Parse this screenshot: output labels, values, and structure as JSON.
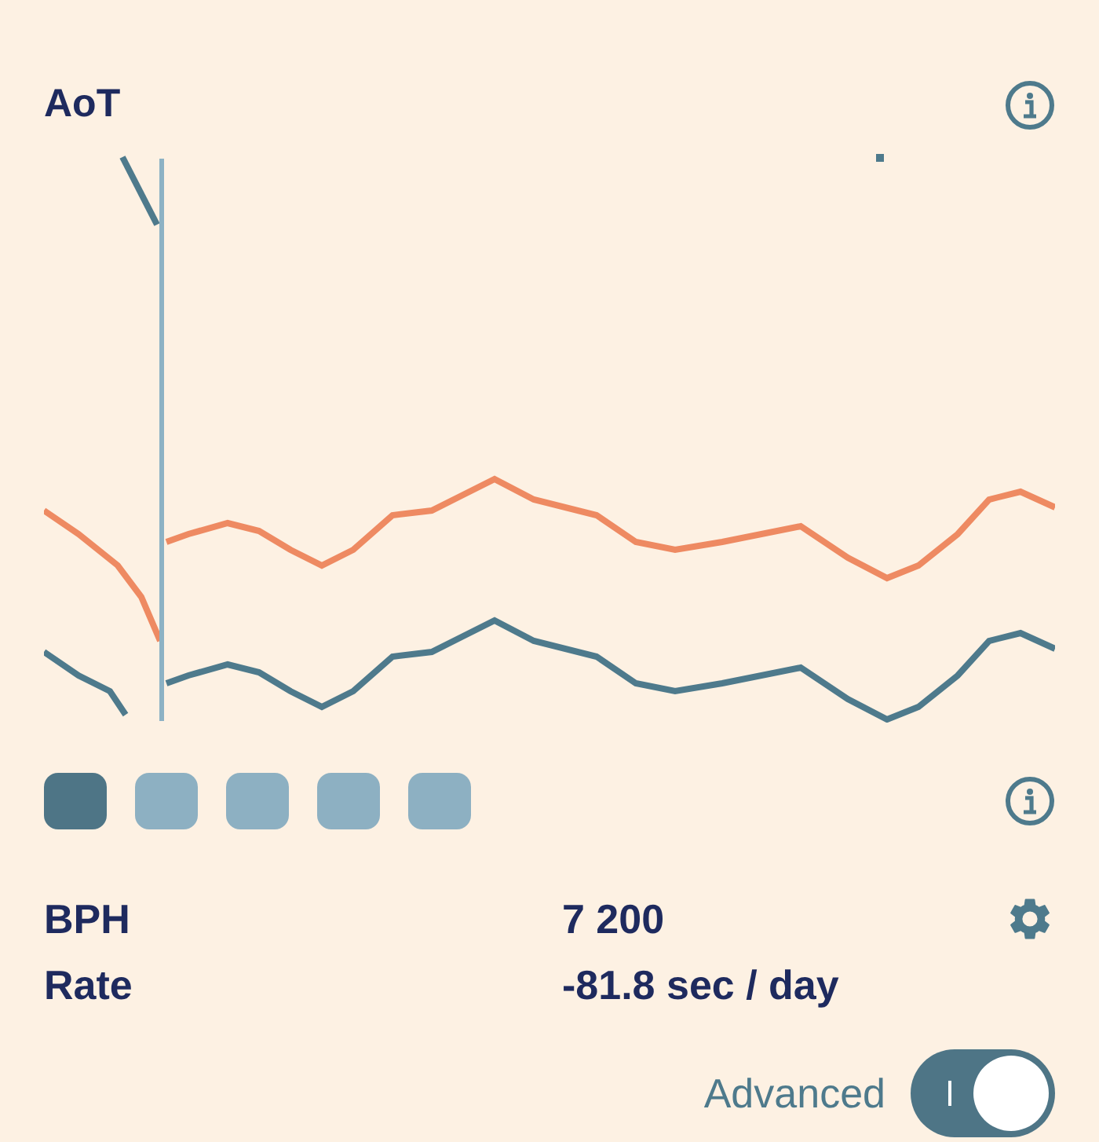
{
  "title": "AoT",
  "segments": [
    {
      "selected": true
    },
    {
      "selected": false
    },
    {
      "selected": false
    },
    {
      "selected": false
    },
    {
      "selected": false
    }
  ],
  "readings": [
    {
      "label": "BPH",
      "value": "7 200"
    },
    {
      "label": "Rate",
      "value": "-81.8 sec / day"
    }
  ],
  "advanced": {
    "label": "Advanced",
    "on": true
  }
}
